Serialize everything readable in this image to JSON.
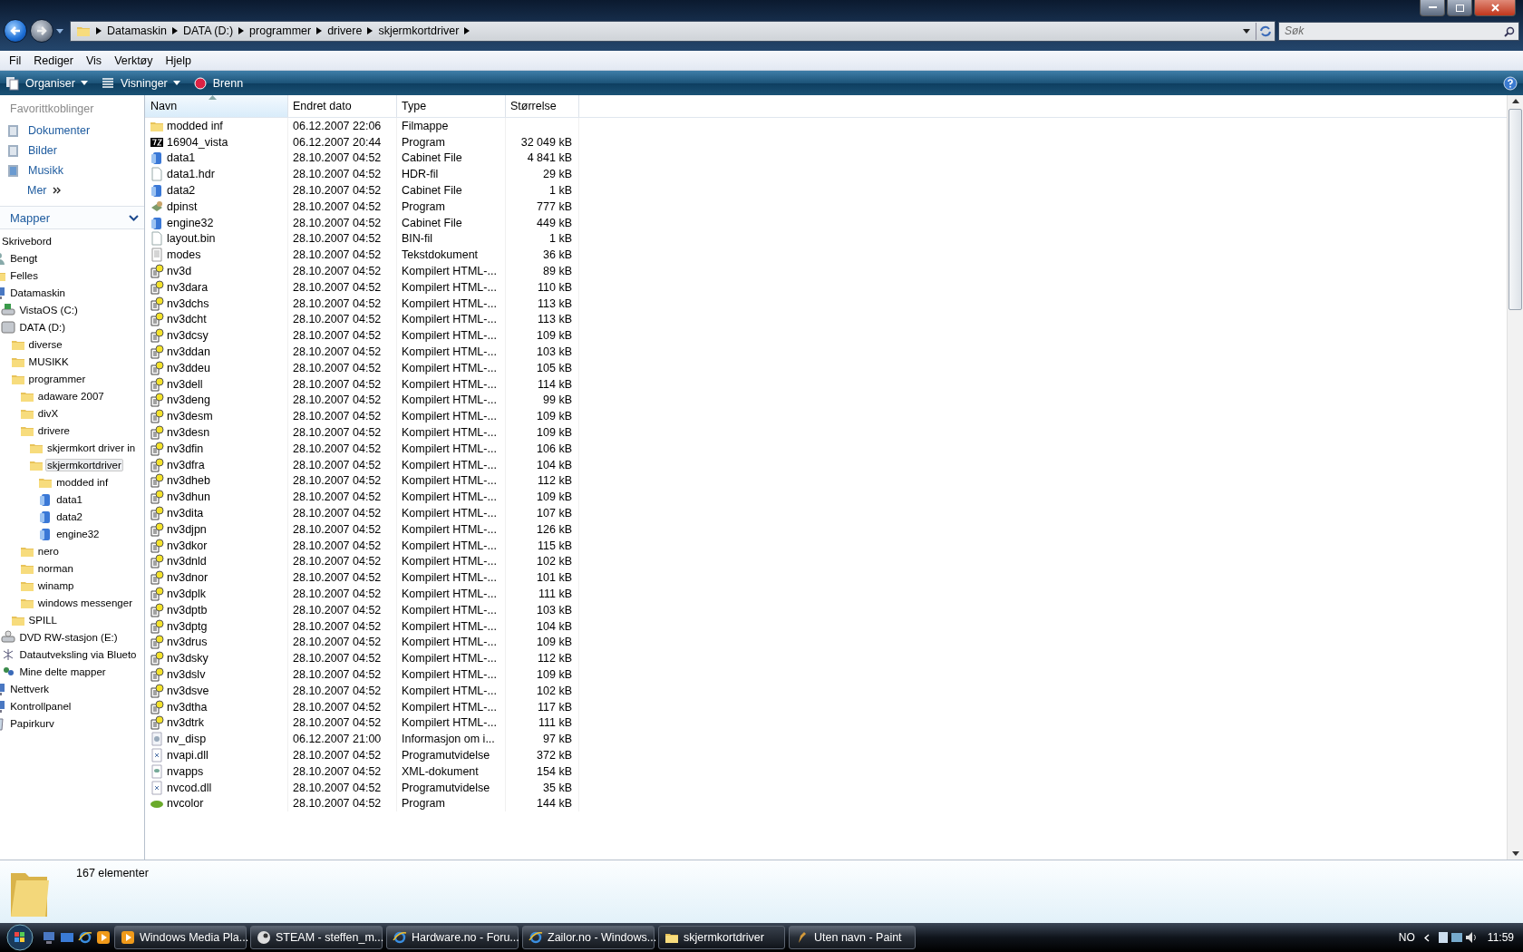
{
  "address_bar": {
    "crumbs": [
      "Datamaskin",
      "DATA (D:)",
      "programmer",
      "drivere",
      "skjermkortdriver"
    ]
  },
  "search": {
    "placeholder": "Søk"
  },
  "menu": [
    "Fil",
    "Rediger",
    "Vis",
    "Verktøy",
    "Hjelp"
  ],
  "toolbar": [
    {
      "label": "Organiser",
      "kind": "organize"
    },
    {
      "label": "Visninger",
      "kind": "views"
    },
    {
      "label": "Brenn",
      "kind": "burn"
    }
  ],
  "favorites": {
    "title": "Favorittkoblinger",
    "items": [
      {
        "label": "Dokumenter",
        "kind": "documents"
      },
      {
        "label": "Bilder",
        "kind": "pictures"
      },
      {
        "label": "Musikk",
        "kind": "music"
      }
    ],
    "more": "Mer"
  },
  "folders": {
    "title": "Mapper",
    "tree": [
      {
        "label": "Skrivebord",
        "selected": false,
        "children": [
          {
            "label": "Bengt",
            "kind": "user",
            "selected": false
          },
          {
            "label": "Felles",
            "kind": "folder",
            "selected": false
          },
          {
            "label": "Datamaskin",
            "kind": "computer",
            "selected": false,
            "children": [
              {
                "label": "VistaOS (C:)",
                "kind": "system-drive",
                "selected": false
              },
              {
                "label": "DATA (D:)",
                "kind": "drive",
                "selected": false,
                "children": [
                  {
                    "label": "diverse",
                    "kind": "folder",
                    "selected": false
                  },
                  {
                    "label": "MUSIKK",
                    "kind": "folder",
                    "selected": false
                  },
                  {
                    "label": "programmer",
                    "kind": "folder",
                    "selected": false,
                    "children": [
                      {
                        "label": "adaware 2007",
                        "kind": "folder",
                        "selected": false
                      },
                      {
                        "label": "divX",
                        "kind": "folder",
                        "selected": false
                      },
                      {
                        "label": "drivere",
                        "kind": "folder",
                        "selected": false,
                        "children": [
                          {
                            "label": "skjermkort driver in",
                            "kind": "folder",
                            "selected": false
                          },
                          {
                            "label": "skjermkortdriver",
                            "kind": "folder",
                            "selected": true,
                            "children": [
                              {
                                "label": "modded inf",
                                "kind": "folder",
                                "selected": false
                              },
                              {
                                "label": "data1",
                                "kind": "cabinet",
                                "selected": false
                              },
                              {
                                "label": "data2",
                                "kind": "cabinet",
                                "selected": false
                              },
                              {
                                "label": "engine32",
                                "kind": "cabinet",
                                "selected": false
                              }
                            ]
                          }
                        ]
                      },
                      {
                        "label": "nero",
                        "kind": "folder",
                        "selected": false
                      },
                      {
                        "label": "norman",
                        "kind": "folder",
                        "selected": false
                      },
                      {
                        "label": "winamp",
                        "kind": "folder",
                        "selected": false
                      },
                      {
                        "label": "windows messenger",
                        "kind": "folder",
                        "selected": false
                      }
                    ]
                  },
                  {
                    "label": "SPILL",
                    "kind": "folder",
                    "selected": false
                  }
                ]
              },
              {
                "label": "DVD RW-stasjon (E:)",
                "kind": "dvd",
                "selected": false
              },
              {
                "label": "Datautveksling via Blueto",
                "kind": "bluetooth",
                "selected": false
              },
              {
                "label": "Mine delte mapper",
                "kind": "shared",
                "selected": false
              }
            ]
          },
          {
            "label": "Nettverk",
            "kind": "network",
            "selected": false
          },
          {
            "label": "Kontrollpanel",
            "kind": "control-panel",
            "selected": false
          },
          {
            "label": "Papirkurv",
            "kind": "recycle",
            "selected": false
          }
        ]
      }
    ]
  },
  "table": {
    "columns": [
      "Navn",
      "Endret dato",
      "Type",
      "Størrelse"
    ],
    "rows": [
      {
        "name": "modded inf",
        "kind": "folder",
        "date": "06.12.2007 22:06",
        "type": "Filmappe"
      },
      {
        "name": "16904_vista",
        "kind": "archive",
        "date": "06.12.2007 20:44",
        "type": "Program",
        "size": "32 049 kB"
      },
      {
        "name": "data1",
        "kind": "cabinet",
        "date": "28.10.2007 04:52",
        "type": "Cabinet File",
        "size": "4 841 kB"
      },
      {
        "name": "data1.hdr",
        "kind": "file",
        "date": "28.10.2007 04:52",
        "type": "HDR-fil",
        "size": "29 kB"
      },
      {
        "name": "data2",
        "kind": "cabinet",
        "date": "28.10.2007 04:52",
        "type": "Cabinet File",
        "size": "1 kB"
      },
      {
        "name": "dpinst",
        "kind": "setup",
        "date": "28.10.2007 04:52",
        "type": "Program",
        "size": "777 kB"
      },
      {
        "name": "engine32",
        "kind": "cabinet",
        "date": "28.10.2007 04:52",
        "type": "Cabinet File",
        "size": "449 kB"
      },
      {
        "name": "layout.bin",
        "kind": "file",
        "date": "28.10.2007 04:52",
        "type": "BIN-fil",
        "size": "1 kB"
      },
      {
        "name": "modes",
        "kind": "text",
        "date": "28.10.2007 04:52",
        "type": "Tekstdokument",
        "size": "36 kB"
      },
      {
        "name": "nv3d",
        "kind": "help",
        "date": "28.10.2007 04:52",
        "type": "Kompilert HTML-...",
        "size": "89 kB"
      },
      {
        "name": "nv3dara",
        "kind": "help",
        "date": "28.10.2007 04:52",
        "type": "Kompilert HTML-...",
        "size": "110 kB"
      },
      {
        "name": "nv3dchs",
        "kind": "help",
        "date": "28.10.2007 04:52",
        "type": "Kompilert HTML-...",
        "size": "113 kB"
      },
      {
        "name": "nv3dcht",
        "kind": "help",
        "date": "28.10.2007 04:52",
        "type": "Kompilert HTML-...",
        "size": "113 kB"
      },
      {
        "name": "nv3dcsy",
        "kind": "help",
        "date": "28.10.2007 04:52",
        "type": "Kompilert HTML-...",
        "size": "109 kB"
      },
      {
        "name": "nv3ddan",
        "kind": "help",
        "date": "28.10.2007 04:52",
        "type": "Kompilert HTML-...",
        "size": "103 kB"
      },
      {
        "name": "nv3ddeu",
        "kind": "help",
        "date": "28.10.2007 04:52",
        "type": "Kompilert HTML-...",
        "size": "105 kB"
      },
      {
        "name": "nv3dell",
        "kind": "help",
        "date": "28.10.2007 04:52",
        "type": "Kompilert HTML-...",
        "size": "114 kB"
      },
      {
        "name": "nv3deng",
        "kind": "help",
        "date": "28.10.2007 04:52",
        "type": "Kompilert HTML-...",
        "size": "99 kB"
      },
      {
        "name": "nv3desm",
        "kind": "help",
        "date": "28.10.2007 04:52",
        "type": "Kompilert HTML-...",
        "size": "109 kB"
      },
      {
        "name": "nv3desn",
        "kind": "help",
        "date": "28.10.2007 04:52",
        "type": "Kompilert HTML-...",
        "size": "109 kB"
      },
      {
        "name": "nv3dfin",
        "kind": "help",
        "date": "28.10.2007 04:52",
        "type": "Kompilert HTML-...",
        "size": "106 kB"
      },
      {
        "name": "nv3dfra",
        "kind": "help",
        "date": "28.10.2007 04:52",
        "type": "Kompilert HTML-...",
        "size": "104 kB"
      },
      {
        "name": "nv3dheb",
        "kind": "help",
        "date": "28.10.2007 04:52",
        "type": "Kompilert HTML-...",
        "size": "112 kB"
      },
      {
        "name": "nv3dhun",
        "kind": "help",
        "date": "28.10.2007 04:52",
        "type": "Kompilert HTML-...",
        "size": "109 kB"
      },
      {
        "name": "nv3dita",
        "kind": "help",
        "date": "28.10.2007 04:52",
        "type": "Kompilert HTML-...",
        "size": "107 kB"
      },
      {
        "name": "nv3djpn",
        "kind": "help",
        "date": "28.10.2007 04:52",
        "type": "Kompilert HTML-...",
        "size": "126 kB"
      },
      {
        "name": "nv3dkor",
        "kind": "help",
        "date": "28.10.2007 04:52",
        "type": "Kompilert HTML-...",
        "size": "115 kB"
      },
      {
        "name": "nv3dnld",
        "kind": "help",
        "date": "28.10.2007 04:52",
        "type": "Kompilert HTML-...",
        "size": "102 kB"
      },
      {
        "name": "nv3dnor",
        "kind": "help",
        "date": "28.10.2007 04:52",
        "type": "Kompilert HTML-...",
        "size": "101 kB"
      },
      {
        "name": "nv3dplk",
        "kind": "help",
        "date": "28.10.2007 04:52",
        "type": "Kompilert HTML-...",
        "size": "111 kB"
      },
      {
        "name": "nv3dptb",
        "kind": "help",
        "date": "28.10.2007 04:52",
        "type": "Kompilert HTML-...",
        "size": "103 kB"
      },
      {
        "name": "nv3dptg",
        "kind": "help",
        "date": "28.10.2007 04:52",
        "type": "Kompilert HTML-...",
        "size": "104 kB"
      },
      {
        "name": "nv3drus",
        "kind": "help",
        "date": "28.10.2007 04:52",
        "type": "Kompilert HTML-...",
        "size": "109 kB"
      },
      {
        "name": "nv3dsky",
        "kind": "help",
        "date": "28.10.2007 04:52",
        "type": "Kompilert HTML-...",
        "size": "112 kB"
      },
      {
        "name": "nv3dslv",
        "kind": "help",
        "date": "28.10.2007 04:52",
        "type": "Kompilert HTML-...",
        "size": "109 kB"
      },
      {
        "name": "nv3dsve",
        "kind": "help",
        "date": "28.10.2007 04:52",
        "type": "Kompilert HTML-...",
        "size": "102 kB"
      },
      {
        "name": "nv3dtha",
        "kind": "help",
        "date": "28.10.2007 04:52",
        "type": "Kompilert HTML-...",
        "size": "117 kB"
      },
      {
        "name": "nv3dtrk",
        "kind": "help",
        "date": "28.10.2007 04:52",
        "type": "Kompilert HTML-...",
        "size": "111 kB"
      },
      {
        "name": "nv_disp",
        "kind": "info",
        "date": "06.12.2007 21:00",
        "type": "Informasjon om i...",
        "size": "97 kB"
      },
      {
        "name": "nvapi.dll",
        "kind": "dll",
        "date": "28.10.2007 04:52",
        "type": "Programutvidelse",
        "size": "372 kB"
      },
      {
        "name": "nvapps",
        "kind": "xml",
        "date": "28.10.2007 04:52",
        "type": "XML-dokument",
        "size": "154 kB"
      },
      {
        "name": "nvcod.dll",
        "kind": "dll",
        "date": "28.10.2007 04:52",
        "type": "Programutvidelse",
        "size": "35 kB"
      },
      {
        "name": "nvcolor",
        "kind": "app",
        "date": "28.10.2007 04:52",
        "type": "Program",
        "size": "144 kB"
      }
    ]
  },
  "details": {
    "count": "167 elementer"
  },
  "taskbar": {
    "tasks": [
      {
        "label": "Windows Media Pla...",
        "kind": "media",
        "selected": false
      },
      {
        "label": "STEAM - steffen_m...",
        "kind": "steam",
        "selected": false
      },
      {
        "label": "Hardware.no - Foru...",
        "kind": "browser",
        "selected": false
      },
      {
        "label": "Zailor.no - Windows...",
        "kind": "browser",
        "selected": false
      },
      {
        "label": "skjermkortdriver",
        "kind": "explorer",
        "selected": true
      },
      {
        "label": "Uten navn - Paint",
        "kind": "paint",
        "selected": false
      }
    ],
    "language": "NO",
    "clock": "11:59"
  }
}
